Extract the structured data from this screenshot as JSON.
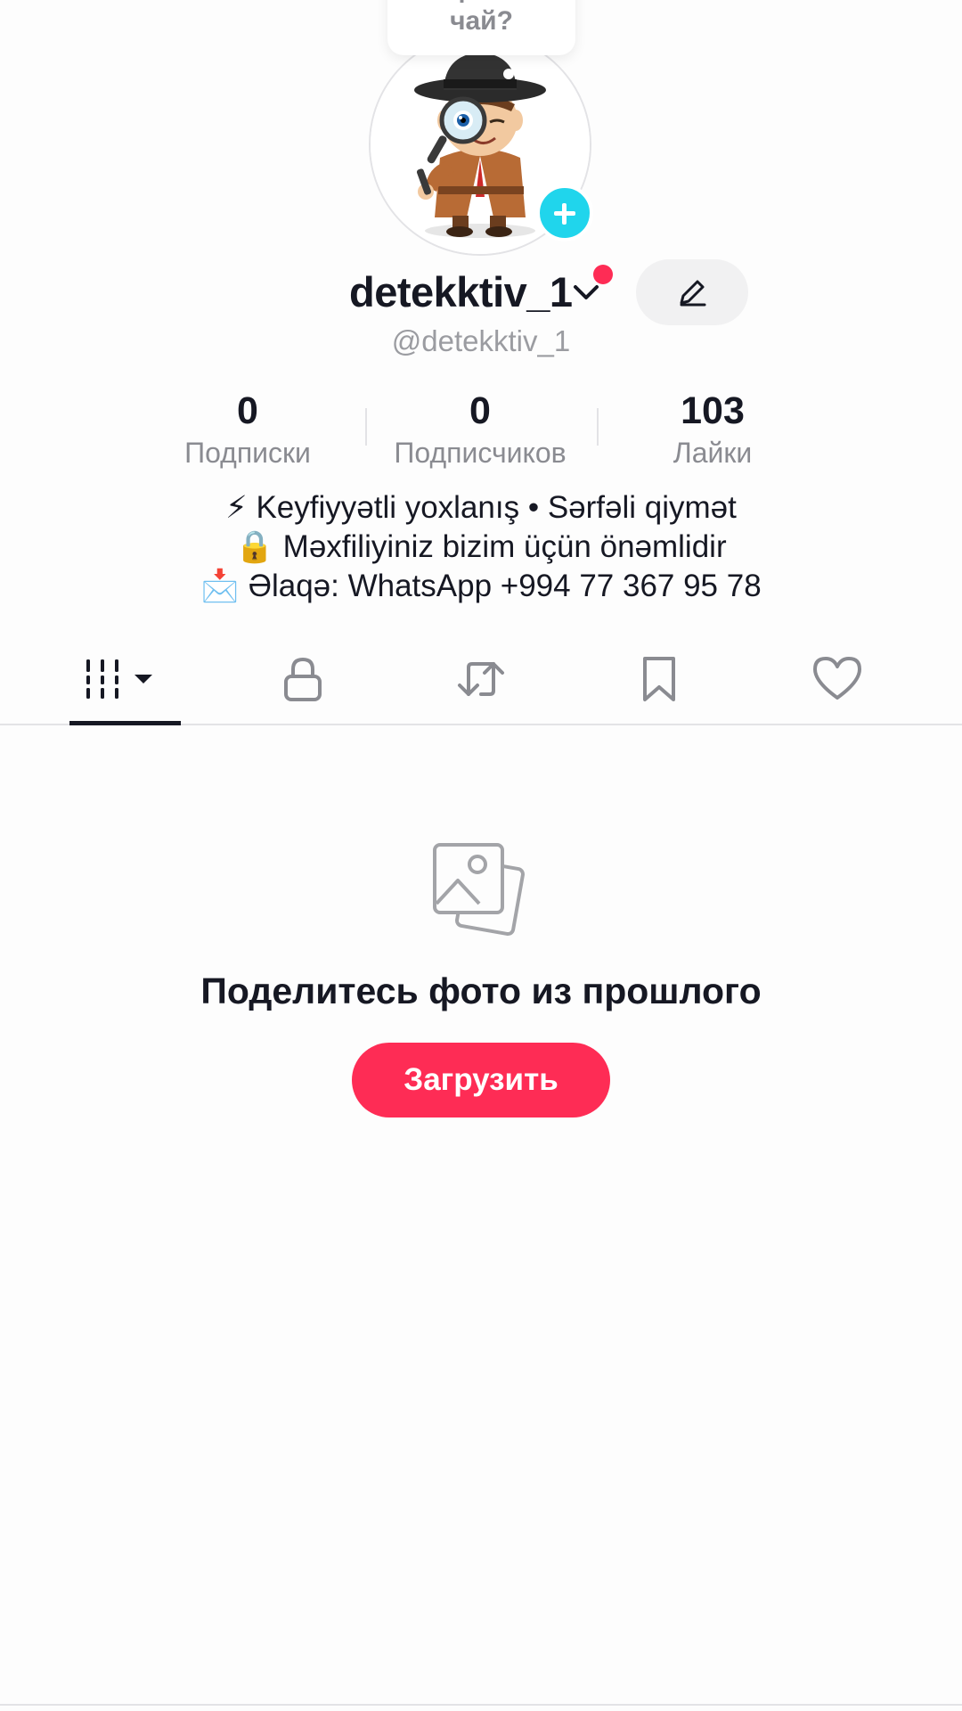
{
  "tooltip": {
    "text": "Кофе или чай?"
  },
  "profile": {
    "display_name": "detekktiv_1",
    "handle": "@detekktiv_1",
    "avatar_alt": "detective cartoon avatar"
  },
  "stats": [
    {
      "value": "0",
      "label": "Подписки"
    },
    {
      "value": "0",
      "label": "Подписчиков"
    },
    {
      "value": "103",
      "label": "Лайки"
    }
  ],
  "bio": {
    "lines": [
      "⚡ Keyfiyyətli yoxlanış • Sərfəli qiymət",
      "🔒 Məxfiliyiniz bizim üçün önəmlidir",
      "📩 Əlaqə: WhatsApp +994 77 367 95 78"
    ]
  },
  "tabs": [
    {
      "icon": "grid-icon",
      "active": true
    },
    {
      "icon": "lock-icon",
      "active": false
    },
    {
      "icon": "repost-icon",
      "active": false
    },
    {
      "icon": "bookmark-icon",
      "active": false
    },
    {
      "icon": "heart-icon",
      "active": false
    }
  ],
  "empty_state": {
    "icon": "photos-icon",
    "title": "Поделитесь фото из прошлого",
    "button_label": "Загрузить"
  },
  "colors": {
    "accent": "#fe2c55",
    "badge": "#20d5ec",
    "text": "#161823",
    "muted": "#8a8b91"
  }
}
